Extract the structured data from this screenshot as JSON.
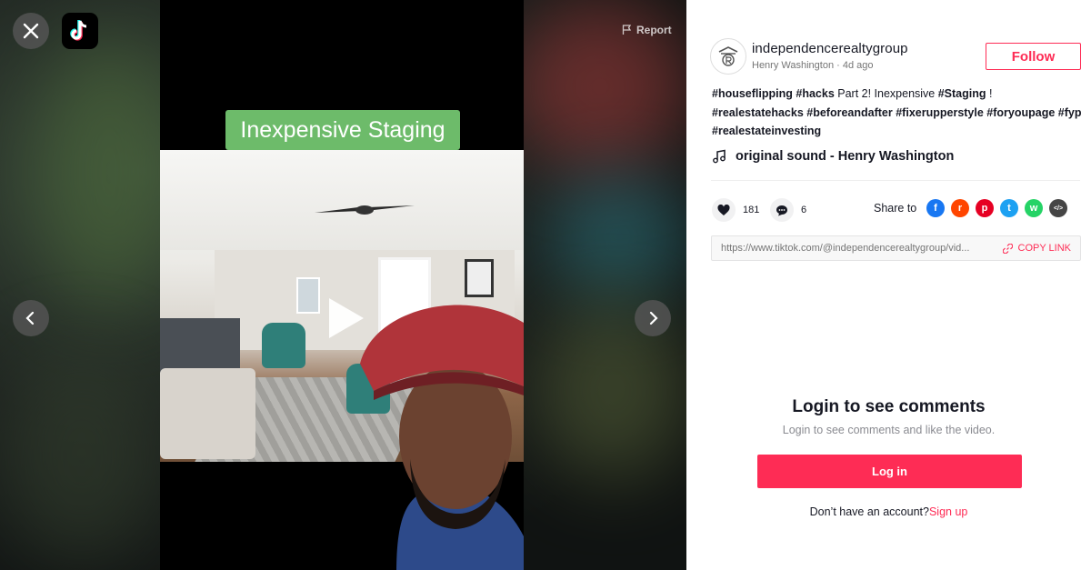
{
  "video": {
    "report_label": "Report",
    "caption_overlay": "Inexpensive Staging"
  },
  "author": {
    "username": "independencerealtygroup",
    "display_name": "Henry Washington",
    "separator": " · ",
    "posted": "4d ago",
    "follow_label": "Follow"
  },
  "description": {
    "segments": [
      {
        "text": "#houseflipping",
        "tag": true
      },
      {
        "text": " ",
        "tag": false
      },
      {
        "text": "#hacks",
        "tag": true
      },
      {
        "text": " Part 2! Inexpensive ",
        "tag": false
      },
      {
        "text": "#Staging",
        "tag": true
      },
      {
        "text": " ! ",
        "tag": false
      },
      {
        "text": "#realestatehacks",
        "tag": true
      },
      {
        "text": " ",
        "tag": false
      },
      {
        "text": "#beforeandafter",
        "tag": true
      },
      {
        "text": " ",
        "tag": false
      },
      {
        "text": "#fixerupperstyle",
        "tag": true
      },
      {
        "text": " ",
        "tag": false
      },
      {
        "text": "#foryoupage",
        "tag": true
      },
      {
        "text": " ",
        "tag": false
      },
      {
        "text": "#fyp",
        "tag": true
      },
      {
        "text": " ",
        "tag": false
      },
      {
        "text": "#realestateinvesting",
        "tag": true
      }
    ]
  },
  "music": {
    "label": "original sound - Henry Washington",
    "icon": "music-note-icon"
  },
  "stats": {
    "likes": "181",
    "comments": "6"
  },
  "share": {
    "label": "Share to",
    "targets": [
      {
        "name": "facebook",
        "color": "#1877f2",
        "glyph": "f"
      },
      {
        "name": "reddit",
        "color": "#ff4500",
        "glyph": "r"
      },
      {
        "name": "pinterest",
        "color": "#e60023",
        "glyph": "p"
      },
      {
        "name": "twitter",
        "color": "#1da1f2",
        "glyph": "t"
      },
      {
        "name": "whatsapp",
        "color": "#25d366",
        "glyph": "w"
      },
      {
        "name": "embed",
        "color": "#454545",
        "glyph": "</>"
      }
    ]
  },
  "link": {
    "url": "https://www.tiktok.com/@independencerealtygroup/vid...",
    "copy_label": "COPY LINK"
  },
  "login": {
    "title": "Login to see comments",
    "subtitle": "Login to see comments and like the video.",
    "button_label": "Log in",
    "no_account": "Don’t have an account?",
    "signup_label": "Sign up"
  },
  "colors": {
    "accent": "#fe2c55",
    "caption_bg": "#6dbb6a"
  }
}
